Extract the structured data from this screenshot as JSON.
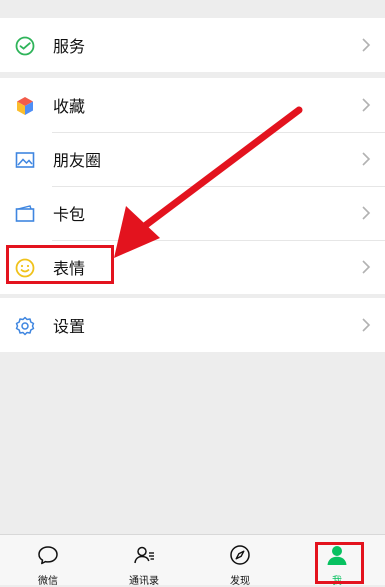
{
  "groups": [
    {
      "items": [
        {
          "label": "服务",
          "icon": "wechat-pay-icon"
        }
      ]
    },
    {
      "items": [
        {
          "label": "收藏",
          "icon": "favorites-cube-icon"
        },
        {
          "label": "朋友圈",
          "icon": "moments-image-icon"
        },
        {
          "label": "卡包",
          "icon": "card-wallet-icon"
        },
        {
          "label": "表情",
          "icon": "smiley-icon"
        }
      ]
    },
    {
      "items": [
        {
          "label": "设置",
          "icon": "gear-icon"
        }
      ]
    }
  ],
  "tabbar": {
    "tabs": [
      {
        "label": "微信",
        "icon": "chat-bubble-icon"
      },
      {
        "label": "通讯录",
        "icon": "contacts-icon"
      },
      {
        "label": "发现",
        "icon": "compass-icon"
      },
      {
        "label": "我",
        "icon": "person-icon",
        "active": true
      }
    ]
  },
  "colors": {
    "accent": "#07c160",
    "annotation": "#e3131e"
  }
}
